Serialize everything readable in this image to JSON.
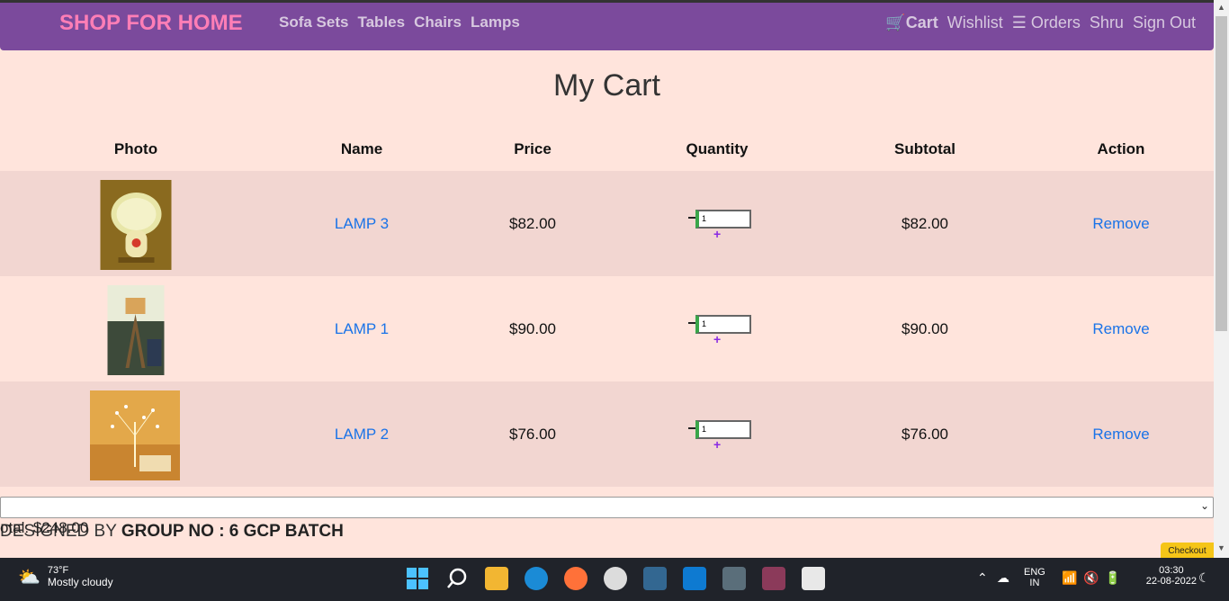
{
  "navbar": {
    "brand": "SHOP FOR HOME",
    "categories": [
      "Sofa Sets",
      "Tables",
      "Chairs",
      "Lamps"
    ],
    "cart_label": "Cart",
    "wishlist_label": "Wishlist",
    "orders_label": "Orders",
    "user_label": "Shru",
    "signout_label": "Sign Out"
  },
  "page_title": "My Cart",
  "table": {
    "headers": [
      "Photo",
      "Name",
      "Price",
      "Quantity",
      "Subtotal",
      "Action"
    ],
    "rows": [
      {
        "name": "LAMP 3",
        "price": "$82.00",
        "quantity": "1",
        "subtotal": "$82.00",
        "action": "Remove"
      },
      {
        "name": "LAMP 1",
        "price": "$90.00",
        "quantity": "1",
        "subtotal": "$90.00",
        "action": "Remove"
      },
      {
        "name": "LAMP 2",
        "price": "$76.00",
        "quantity": "1",
        "subtotal": "$76.00",
        "action": "Remove"
      }
    ],
    "minus_symbol": "−",
    "plus_symbol": "+"
  },
  "total_label": "otal: $248.00",
  "footer": {
    "prefix": "DESIGNED BY ",
    "group": "GROUP NO : 6 GCP BATCH"
  },
  "checkout_label": "Checkout",
  "taskbar": {
    "weather_temp": "73°F",
    "weather_desc": "Mostly cloudy",
    "lang_top": "ENG",
    "lang_bottom": "IN",
    "time": "03:30",
    "date": "22-08-2022"
  },
  "colors": {
    "navbar": "#7b4a9c",
    "brand": "#ff7eb6",
    "page_bg": "#ffe4dc",
    "link": "#1a73e8"
  }
}
